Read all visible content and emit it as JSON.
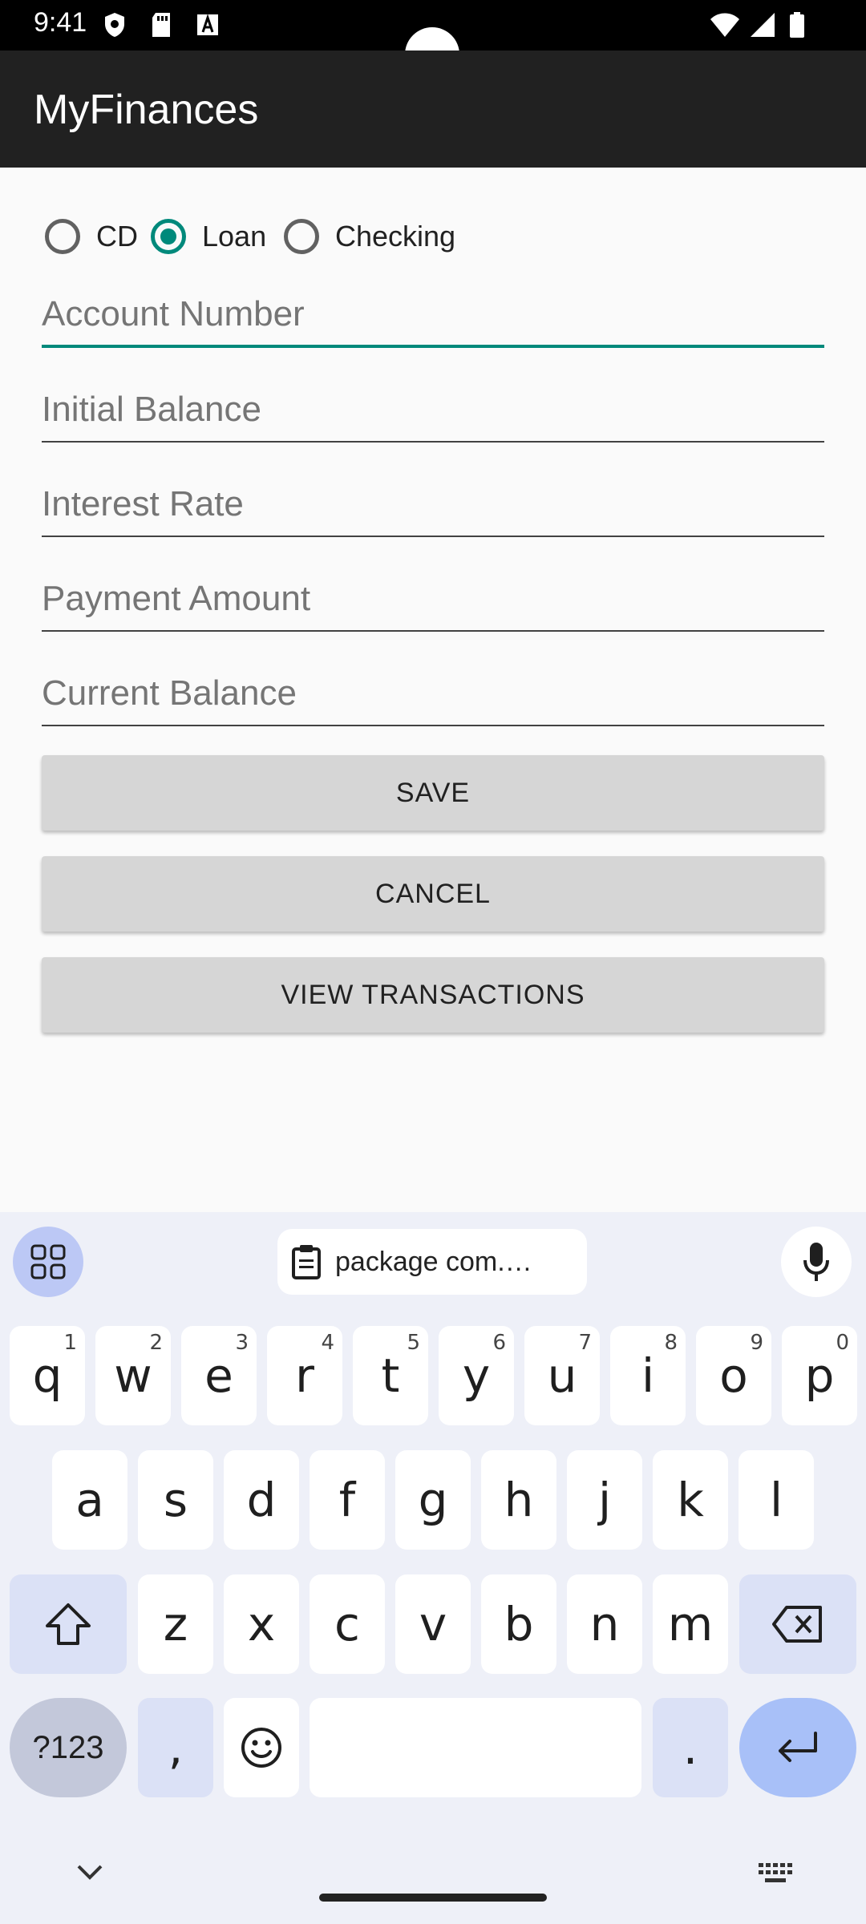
{
  "status_bar": {
    "time": "9:41"
  },
  "app_bar": {
    "title": "MyFinances"
  },
  "account_type": {
    "options": [
      {
        "label": "CD",
        "checked": false
      },
      {
        "label": "Loan",
        "checked": true
      },
      {
        "label": "Checking",
        "checked": false
      }
    ]
  },
  "fields": {
    "account_number": {
      "placeholder": "Account Number",
      "value": ""
    },
    "initial_balance": {
      "placeholder": "Initial Balance",
      "value": ""
    },
    "interest_rate": {
      "placeholder": "Interest Rate",
      "value": ""
    },
    "payment_amount": {
      "placeholder": "Payment Amount",
      "value": ""
    },
    "current_balance": {
      "placeholder": "Current Balance",
      "value": ""
    }
  },
  "buttons": {
    "save": "SAVE",
    "cancel": "CANCEL",
    "view_transactions": "VIEW TRANSACTIONS"
  },
  "keyboard": {
    "suggestion": "package com.…",
    "row1": [
      {
        "key": "q",
        "hint": "1"
      },
      {
        "key": "w",
        "hint": "2"
      },
      {
        "key": "e",
        "hint": "3"
      },
      {
        "key": "r",
        "hint": "4"
      },
      {
        "key": "t",
        "hint": "5"
      },
      {
        "key": "y",
        "hint": "6"
      },
      {
        "key": "u",
        "hint": "7"
      },
      {
        "key": "i",
        "hint": "8"
      },
      {
        "key": "o",
        "hint": "9"
      },
      {
        "key": "p",
        "hint": "0"
      }
    ],
    "row2": [
      "a",
      "s",
      "d",
      "f",
      "g",
      "h",
      "j",
      "k",
      "l"
    ],
    "row3": [
      "z",
      "x",
      "c",
      "v",
      "b",
      "n",
      "m"
    ],
    "symbols": "?123",
    "comma": ",",
    "period": "."
  },
  "colors": {
    "accent": "#00897b",
    "app_bar": "#212121",
    "button": "#d6d6d6",
    "keyboard_bg": "#eef0f8"
  }
}
